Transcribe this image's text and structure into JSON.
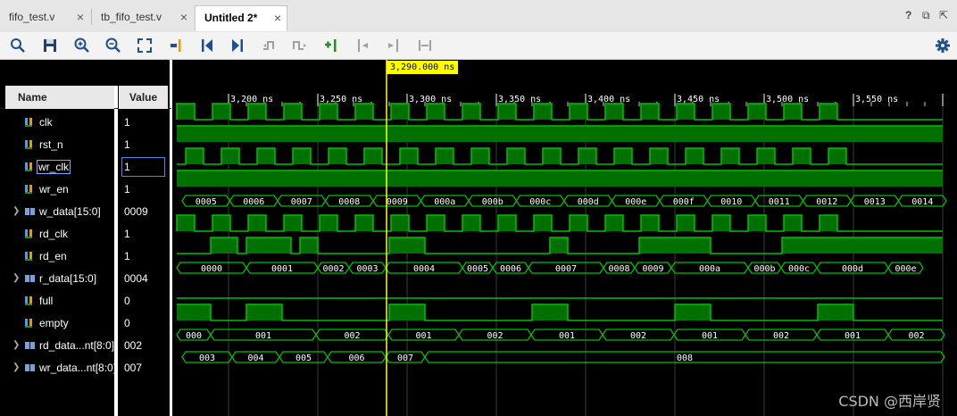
{
  "tabs": [
    {
      "label": "fifo_test.v",
      "active": false
    },
    {
      "label": "tb_fifo_test.v",
      "active": false
    },
    {
      "label": "Untitled 2*",
      "active": true
    }
  ],
  "window_controls": {
    "help": "?",
    "restore": "⧉",
    "float": "⇱"
  },
  "toolbar_icons": [
    "zoom-fit-search-icon",
    "save-icon",
    "zoom-in-icon",
    "zoom-out-icon",
    "full-view-icon",
    "goto-cursor-icon",
    "goto-time0-icon",
    "goto-last-time-icon",
    "prev-transition-icon",
    "next-transition-icon",
    "add-marker-icon",
    "prev-marker-icon",
    "next-marker-icon",
    "swap-cursors-icon",
    "settings-icon"
  ],
  "columns": {
    "name": "Name",
    "value": "Value"
  },
  "cursor_time": "3,290.000 ns",
  "time_ticks": [
    "3,200 ns",
    "3,250 ns",
    "3,300 ns",
    "3,350 ns",
    "3,400 ns",
    "3,450 ns",
    "3,500 ns",
    "3,550 ns"
  ],
  "signals": [
    {
      "name": "clk",
      "value": "1",
      "bus": false
    },
    {
      "name": "rst_n",
      "value": "1",
      "bus": false
    },
    {
      "name": "wr_clk",
      "value": "1",
      "bus": false,
      "selected": true
    },
    {
      "name": "wr_en",
      "value": "1",
      "bus": false
    },
    {
      "name": "w_data[15:0]",
      "value": "0009",
      "bus": true
    },
    {
      "name": "rd_clk",
      "value": "1",
      "bus": false
    },
    {
      "name": "rd_en",
      "value": "1",
      "bus": false
    },
    {
      "name": "r_data[15:0]",
      "value": "0004",
      "bus": true
    },
    {
      "name": "full",
      "value": "0",
      "bus": false
    },
    {
      "name": "empty",
      "value": "0",
      "bus": false
    },
    {
      "name": "rd_data...nt[8:0]",
      "value": "002",
      "bus": true
    },
    {
      "name": "wr_data...nt[8:0]",
      "value": "007",
      "bus": true
    }
  ],
  "bus_values": {
    "w_data": [
      "0005",
      "0006",
      "0007",
      "0008",
      "0009",
      "000a",
      "000b",
      "000c",
      "000d",
      "000e",
      "000f",
      "0010",
      "0011",
      "0012",
      "0013",
      "0014"
    ],
    "r_data": [
      "0000",
      "0001",
      "0002",
      "0003",
      "0004",
      "0005",
      "0006",
      "0007",
      "0008",
      "0009",
      "000a",
      "000b",
      "000c",
      "000d",
      "000e"
    ],
    "rd_count": [
      "000",
      "001",
      "002",
      "001",
      "002",
      "001",
      "002",
      "001",
      "002",
      "001",
      "002"
    ],
    "wr_count": [
      "003",
      "004",
      "005",
      "006",
      "007",
      "008"
    ]
  },
  "colors": {
    "wave": "#00c000",
    "wave_fill": "#007000",
    "cursor": "#ffff00",
    "grid": "#3a3a3a"
  },
  "watermark": "CSDN @西岸贤"
}
